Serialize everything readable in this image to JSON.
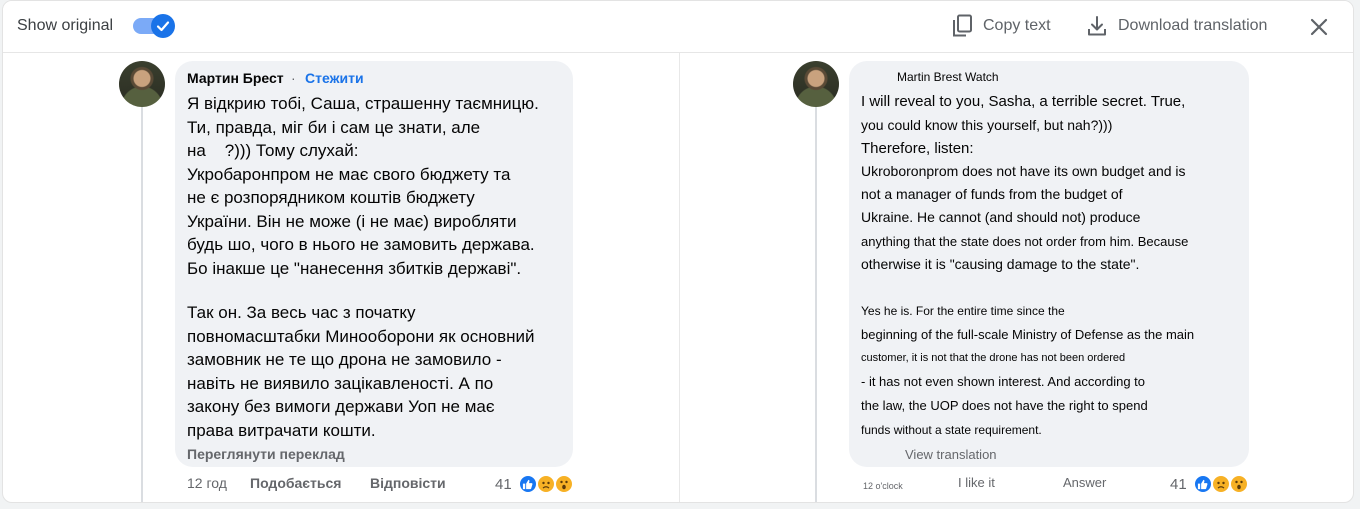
{
  "toolbar": {
    "show_original_label": "Show original",
    "show_original_checked": true,
    "copy_label": "Copy text",
    "download_label": "Download translation"
  },
  "original": {
    "author": "Мартин Брест",
    "separator": "·",
    "follow_label": "Стежити",
    "paragraph1": "Я відкрию тобі, Саша, страшенну таємницю.\nТи, правда, міг би і сам це знати, але\nна    ?))) Тому слухай:\nУкробаронпром не має свого бюджету та\nне є розпорядником коштів бюджету\nУкраїни. Він не може (і не має) виробляти\nбудь шо, чого в нього не замовить держава.\nБо інакше це \"нанесення збитків державі\".",
    "paragraph2": "Так он. За весь час з початку\nповномасштабки Минооборони як основний\nзамовник не те що дрона не замовило -\nнавіть не виявило зацікавленості. А по\nзакону без вимоги держави Уоп не має\nправа витрачати кошти.",
    "see_translation": "Переглянути переклад",
    "time": "12 год",
    "like_label": "Подобається",
    "reply_label": "Відповісти",
    "reaction_count": "41"
  },
  "translated": {
    "header": "Martin Brest Watch",
    "lines": [
      "I will reveal to you, Sasha, a terrible secret. True,",
      "you could know this yourself, but nah?)))",
      "Therefore, listen:",
      "Ukroboronprom does not have its own budget and is",
      "not a manager of funds from the budget of",
      "Ukraine. He cannot (and should not) produce",
      "anything that the state does not order from him. Because",
      "otherwise it is \"causing damage to the state\".",
      "Yes he is. For the entire time since the",
      "beginning of the full-scale Ministry of Defense as the main",
      "customer, it is not that the drone has not been ordered",
      "- it has not even shown interest. And according to",
      "the law, the UOP does not have the right to spend",
      "funds without a state requirement."
    ],
    "view_translation": "View translation",
    "time": "12 o'clock",
    "like_label": "I like it",
    "reply_label": "Answer",
    "reaction_count": "41"
  },
  "icons": {
    "copy": "copy-icon",
    "download": "download-icon",
    "close": "close-icon",
    "check": "check-icon",
    "like": "like-reaction-icon",
    "sad": "sad-reaction-icon",
    "wow": "wow-reaction-icon"
  },
  "colors": {
    "accent": "#1a73e8",
    "bubble": "#f0f2f5",
    "text": "#050505",
    "muted": "#65676b"
  }
}
